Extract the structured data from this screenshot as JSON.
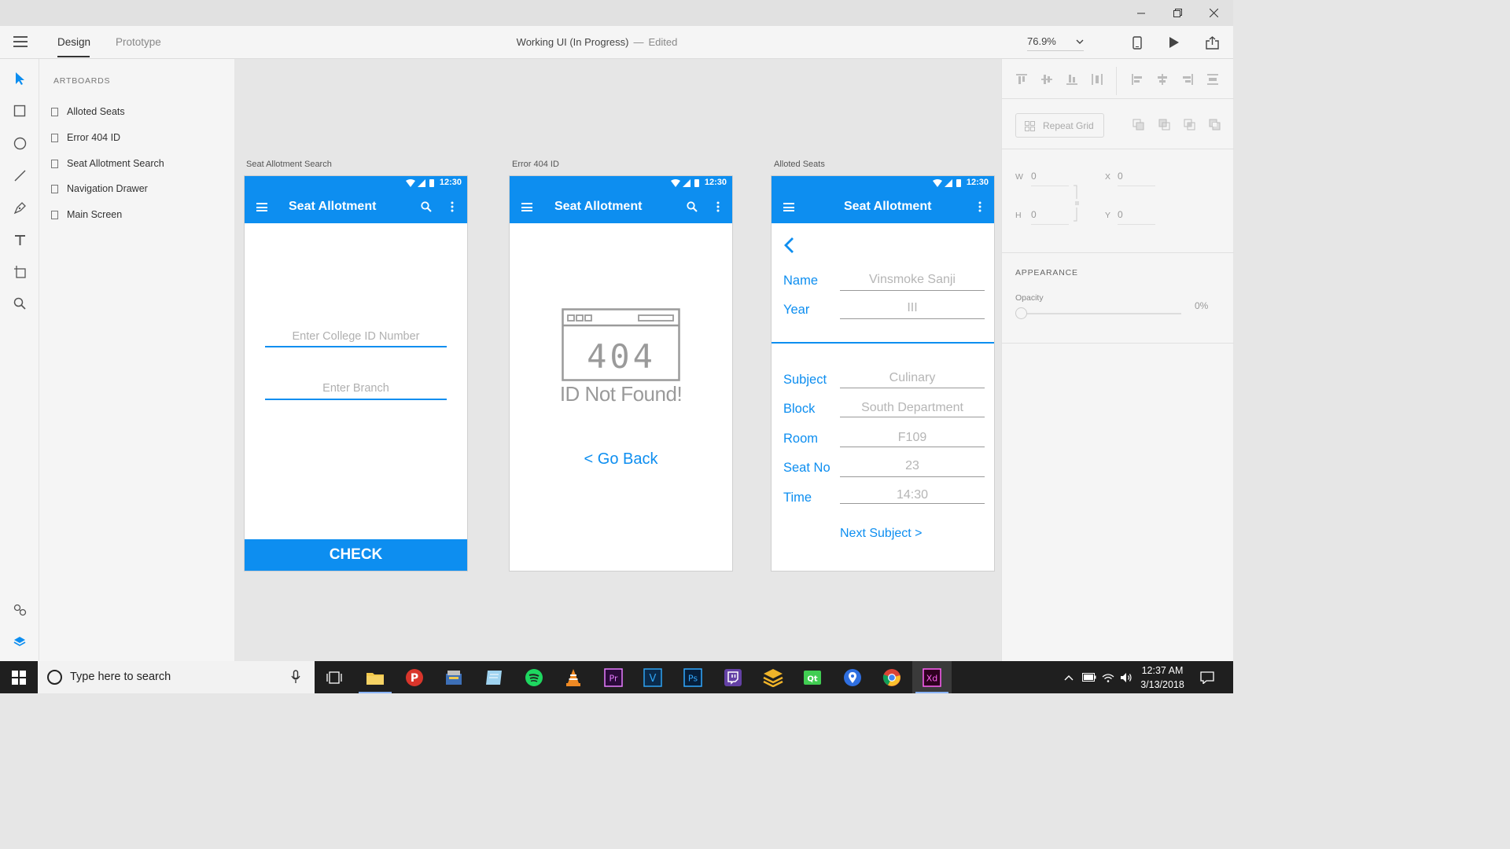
{
  "window": {
    "title": "Working UI (In Progress)",
    "status": "Edited",
    "dash": "—"
  },
  "toolbar": {
    "tabs": [
      "Design",
      "Prototype"
    ],
    "zoom": "76.9%"
  },
  "artboards_panel": {
    "title": "ARTBOARDS",
    "items": [
      "Alloted Seats",
      "Error 404 ID",
      "Seat Allotment Search",
      "Navigation Drawer",
      "Main Screen"
    ]
  },
  "canvas": {
    "artboards": [
      {
        "label": "Seat Allotment Search",
        "status_time": "12:30",
        "app_title": "Seat Allotment",
        "fields": [
          "Enter College ID Number",
          "Enter Branch"
        ],
        "button": "CHECK"
      },
      {
        "label": "Error 404 ID",
        "status_time": "12:30",
        "app_title": "Seat Allotment",
        "error_code": "404",
        "message": "ID Not Found!",
        "back": "< Go Back"
      },
      {
        "label": "Alloted Seats",
        "status_time": "12:30",
        "app_title": "Seat Allotment",
        "student": [
          {
            "key": "Name",
            "value": "Vinsmoke Sanji"
          },
          {
            "key": "Year",
            "value": "III"
          }
        ],
        "details": [
          {
            "key": "Subject",
            "value": "Culinary"
          },
          {
            "key": "Block",
            "value": "South Department"
          },
          {
            "key": "Room",
            "value": "F109"
          },
          {
            "key": "Seat No",
            "value": "23"
          },
          {
            "key": "Time",
            "value": "14:30"
          }
        ],
        "next": "Next Subject >"
      }
    ]
  },
  "properties": {
    "repeat_grid": "Repeat Grid",
    "w_label": "W",
    "w_value": "0",
    "h_label": "H",
    "h_value": "0",
    "x_label": "X",
    "x_value": "0",
    "y_label": "Y",
    "y_value": "0",
    "appearance": "APPEARANCE",
    "opacity_label": "Opacity",
    "opacity_value": "0%",
    "opacity": 0
  },
  "taskbar": {
    "search_placeholder": "Type here to search",
    "time": "12:37 AM",
    "date": "3/13/2018",
    "apps": [
      "task-view",
      "file-explorer",
      "app-p",
      "file-manager",
      "notes",
      "spotify",
      "vlc",
      "premiere-pro",
      "visual-studio",
      "photoshop",
      "twitch",
      "layers-app",
      "qt-creator",
      "maps",
      "chrome",
      "adobe-xd"
    ],
    "active_app": "adobe-xd"
  },
  "colors": {
    "accent": "#0d8ef0",
    "canvas": "#e6e6e6",
    "panel": "#f5f5f5",
    "taskbar": "#1f1f1f"
  }
}
